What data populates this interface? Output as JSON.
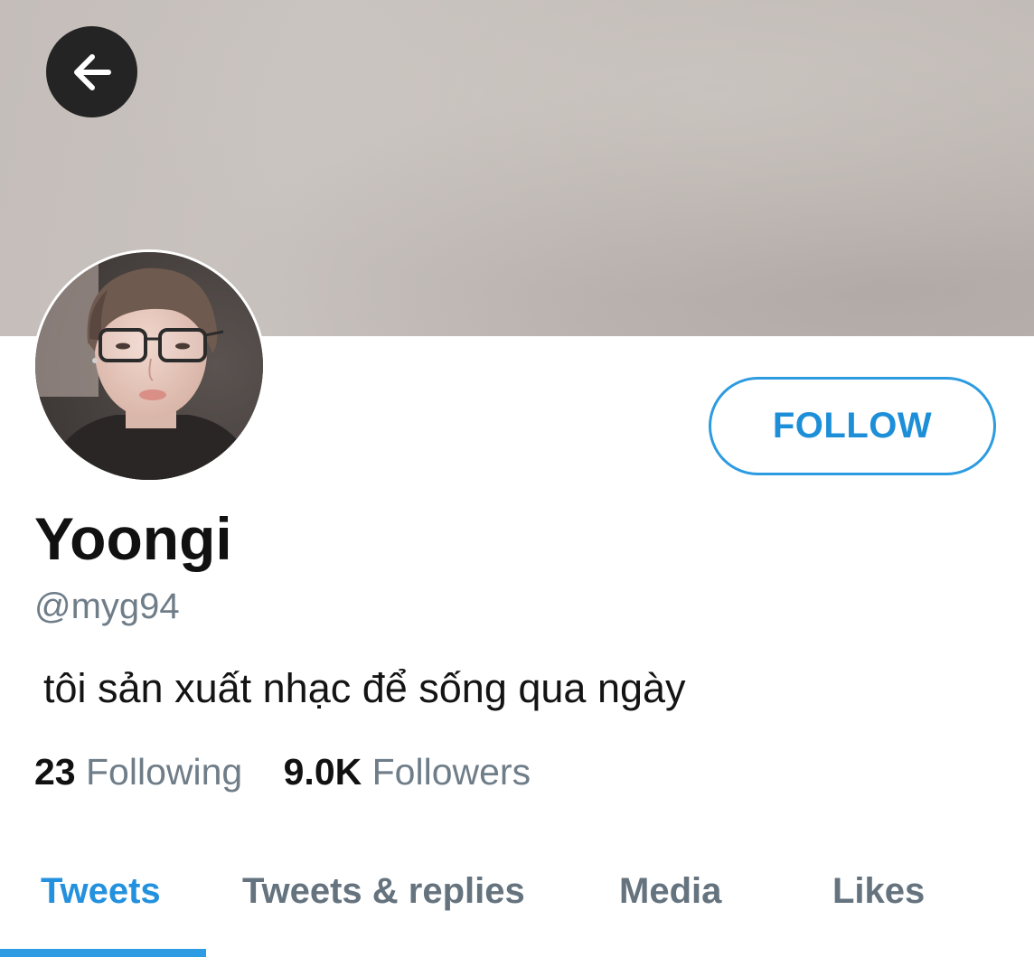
{
  "header": {
    "back_icon": "arrow-left-icon"
  },
  "profile": {
    "display_name": "Yoongi",
    "handle": "@myg94",
    "bio": "tôi sản xuất nhạc để sống qua ngày",
    "follow_label": "FOLLOW"
  },
  "stats": {
    "following_count": "23",
    "following_label": "Following",
    "followers_count": "9.0K",
    "followers_label": "Followers"
  },
  "tabs": [
    {
      "label": "Tweets",
      "active": true
    },
    {
      "label": "Tweets & replies",
      "active": false
    },
    {
      "label": "Media",
      "active": false
    },
    {
      "label": "Likes",
      "active": false
    }
  ],
  "colors": {
    "accent": "#1d8fd8",
    "secondary_text": "#6f7d88",
    "banner": "#c4bdb9"
  }
}
